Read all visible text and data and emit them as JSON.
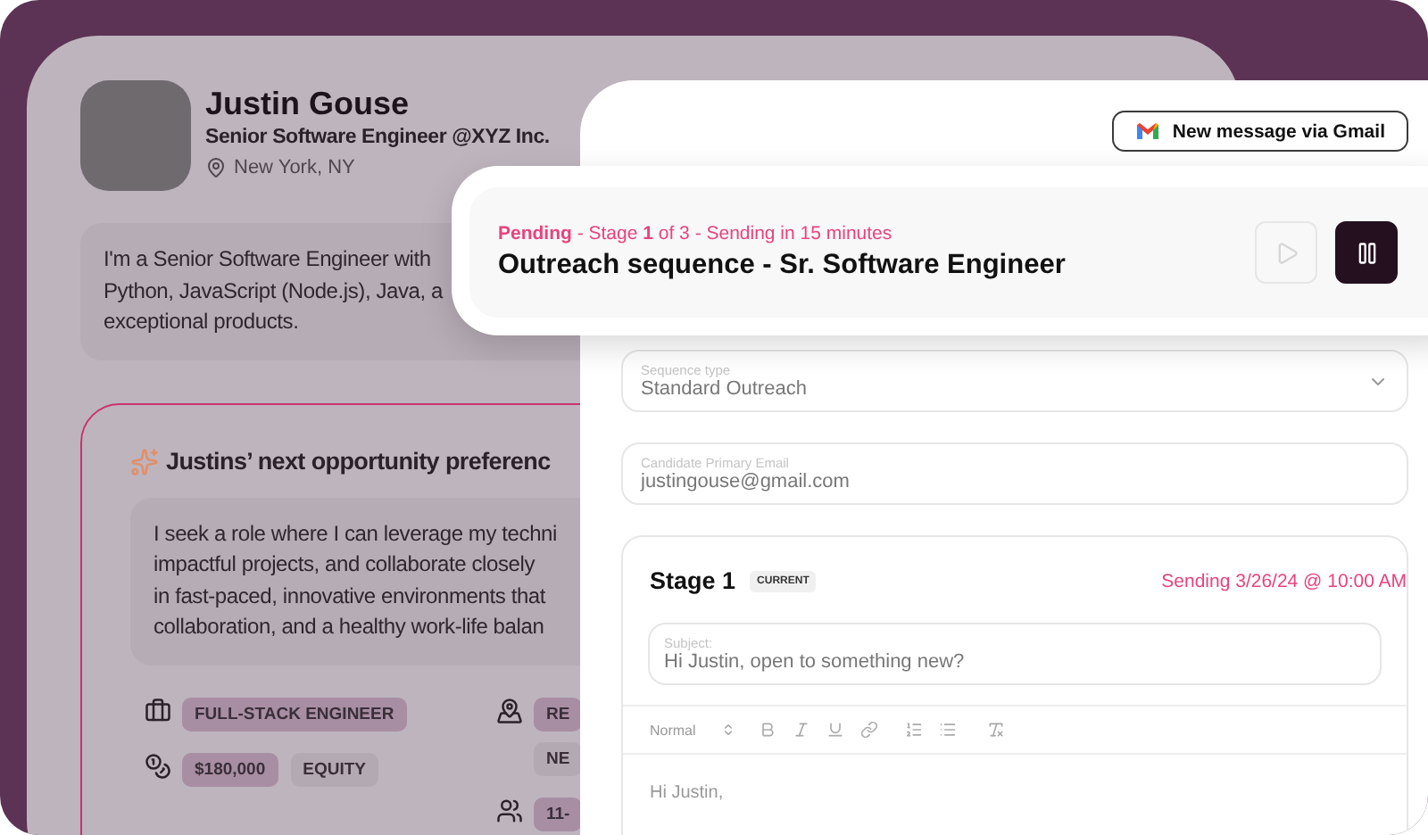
{
  "profile": {
    "name": "Justin Gouse",
    "headline": "Senior Software Engineer @XYZ Inc.",
    "location": "New York, NY",
    "bio_lines": [
      "I'm a Senior Software Engineer with",
      "Python, JavaScript (Node.js), Java, a",
      "exceptional products."
    ]
  },
  "preferences": {
    "title": "Justins’ next opportunity preferenc",
    "summary_lines": [
      "I seek a role where I can leverage my techni",
      "impactful projects, and collaborate closely",
      "in fast-paced, innovative environments that",
      "collaboration, and a healthy work-life balan"
    ],
    "tag_columns": [
      {
        "groups": [
          {
            "kind": "role",
            "tags": [
              {
                "label": "FULL-STACK ENGINEER",
                "kind": "primary"
              }
            ]
          },
          {
            "kind": "compensation",
            "tags": [
              {
                "label": "$180,000",
                "kind": "primary"
              },
              {
                "label": "EQUITY",
                "kind": "secondary"
              }
            ]
          }
        ]
      },
      {
        "groups": [
          {
            "kind": "location",
            "tags": [
              {
                "label": "RE",
                "kind": "primary"
              },
              {
                "label": "NE",
                "kind": "secondary"
              }
            ]
          },
          {
            "kind": "company_size",
            "tags": [
              {
                "label": "11-",
                "kind": "primary"
              }
            ]
          }
        ]
      }
    ]
  },
  "gmail_button": {
    "label": "New message via Gmail"
  },
  "sequence_banner": {
    "status": "**Pending** - Stage **1** of 3 - Sending in 15 minutes",
    "title": "Outreach sequence - Sr. Software Engineer",
    "play_disabled": true
  },
  "fields": [
    {
      "kind": "select",
      "label": "Sequence type",
      "value": "Standard Outreach"
    },
    {
      "kind": "text",
      "label": "Candidate Primary Email",
      "value": "justingouse@gmail.com"
    }
  ],
  "stage": {
    "title": "Stage 1",
    "badge": "CURRENT",
    "schedule": "Sending 3/26/24 @ 10:00 AM",
    "subject_label": "Subject:",
    "subject": "Hi Justin, open to something new?",
    "format": "Normal",
    "body": "Hi Justin,"
  }
}
